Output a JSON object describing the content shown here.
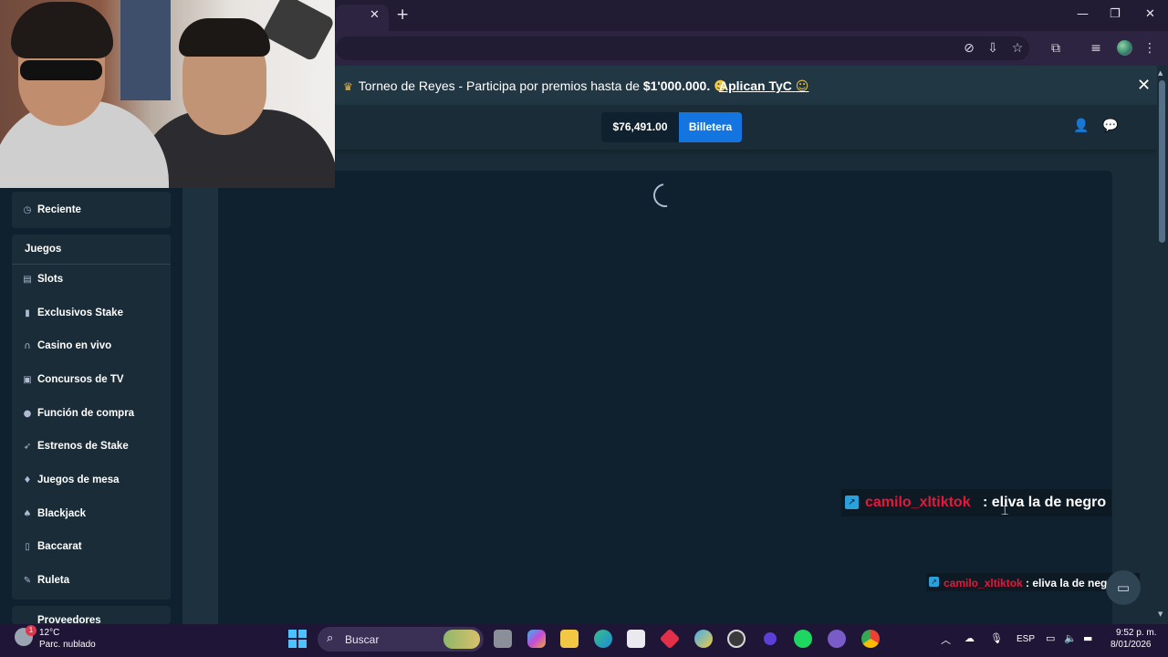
{
  "banner": {
    "text_prefix": "Torneo de Reyes - Participa por premios hasta de ",
    "amount": "$1'000.000.",
    "link": "Aplican TyC",
    "close": "✕"
  },
  "header": {
    "balance": "$76,491.00",
    "wallet_label": "Billetera"
  },
  "sidebar": {
    "recent_label": "Reciente",
    "section_title": "Juegos",
    "items": [
      {
        "label": "Slots",
        "icon": "slots-icon"
      },
      {
        "label": "Exclusivos Stake",
        "icon": "bookmark-icon"
      },
      {
        "label": "Casino en vivo",
        "icon": "headset-icon"
      },
      {
        "label": "Concursos de TV",
        "icon": "gift-icon"
      },
      {
        "label": "Función de compra",
        "icon": "coin-icon"
      },
      {
        "label": "Estrenos de Stake",
        "icon": "rocket-icon"
      },
      {
        "label": "Juegos de mesa",
        "icon": "drop-icon"
      },
      {
        "label": "Blackjack",
        "icon": "spade-icon"
      },
      {
        "label": "Baccarat",
        "icon": "card-icon"
      },
      {
        "label": "Ruleta",
        "icon": "roulette-icon"
      }
    ],
    "next_section_partial": "Proveedores"
  },
  "chat": {
    "username": "camilo_xltiktok",
    "message": ": eliva la de negro"
  },
  "taskbar": {
    "weather_temp": "12°C",
    "weather_desc": "Parc. nublado",
    "weather_badge": "1",
    "search_label": "Buscar",
    "language": "ESP",
    "time": "9:52 p. m.",
    "date": "8/01/2026"
  },
  "colors": {
    "background": "#1a2c38",
    "panel": "#0f212e",
    "accent_blue": "#1475e1",
    "chat_user": "#e8163b",
    "browser_frame": "#2c2440"
  }
}
